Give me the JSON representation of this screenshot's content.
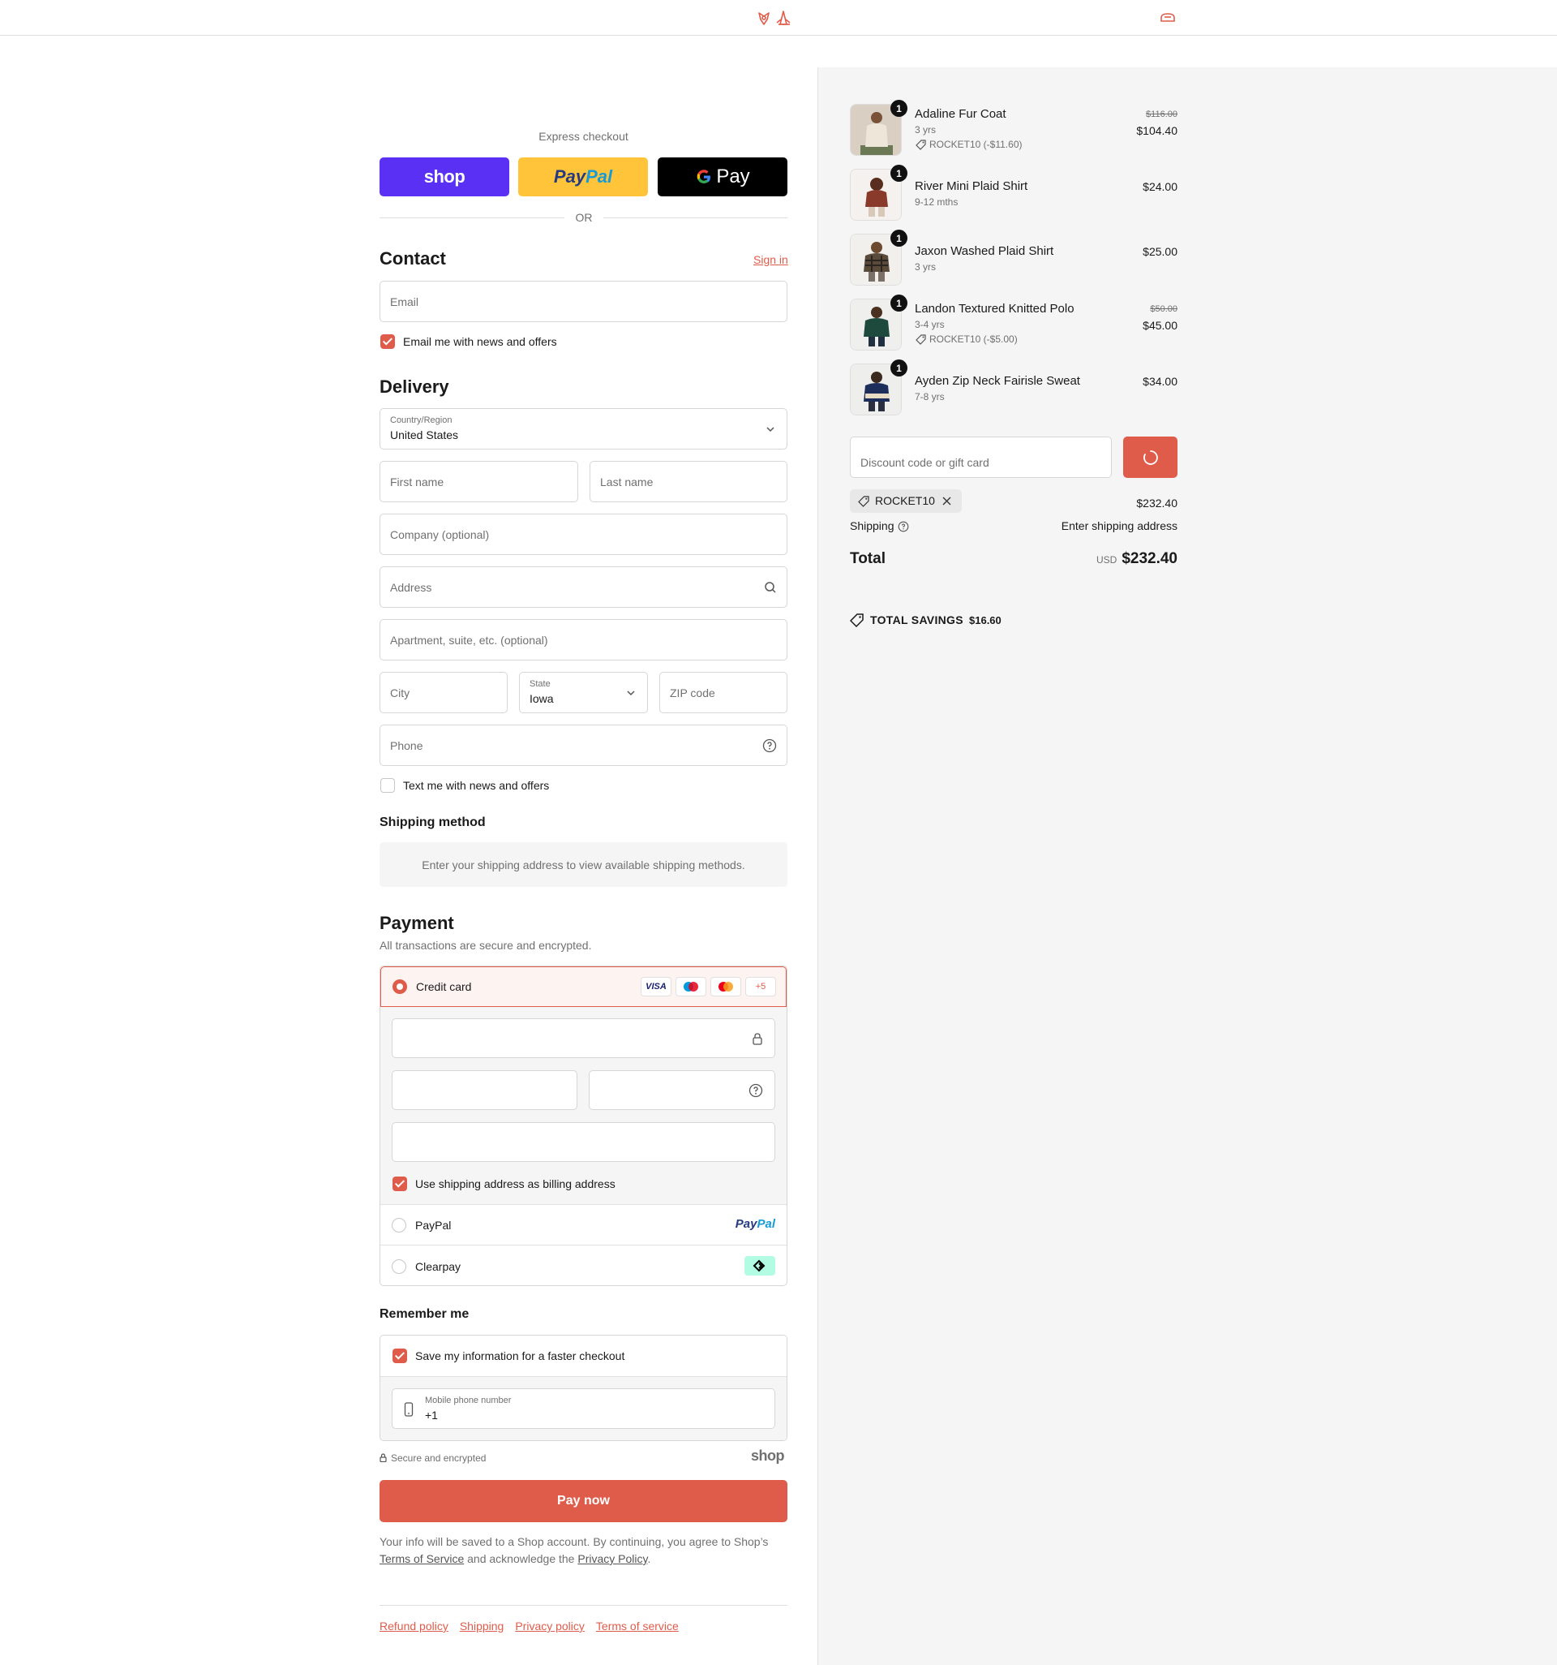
{
  "header": {
    "logo_icon": "rocket-flower-logo",
    "cart_icon": "cart-icon"
  },
  "express": {
    "title": "Express checkout",
    "shop_label": "shop",
    "paypal_label_1": "Pay",
    "paypal_label_2": "Pal",
    "gpay_label": "Pay",
    "or_label": "OR"
  },
  "contact": {
    "heading": "Contact",
    "sign_in": "Sign in",
    "email_placeholder": "Email",
    "email_offers": "Email me with news and offers"
  },
  "delivery": {
    "heading": "Delivery",
    "country_label": "Country/Region",
    "country_value": "United States",
    "first_name": "First name",
    "last_name": "Last name",
    "company": "Company (optional)",
    "address": "Address",
    "apartment": "Apartment, suite, etc. (optional)",
    "city": "City",
    "state_label": "State",
    "state_value": "Iowa",
    "zip": "ZIP code",
    "phone": "Phone",
    "text_offers": "Text me with news and offers"
  },
  "shipping_method": {
    "heading": "Shipping method",
    "message": "Enter your shipping address to view available shipping methods."
  },
  "payment": {
    "heading": "Payment",
    "subtitle": "All transactions are secure and encrypted.",
    "credit_card": "Credit card",
    "visa": "VISA",
    "more_cards": "+5",
    "billing_same": "Use shipping address as billing address",
    "paypal": "PayPal",
    "paypal_logo_1": "Pay",
    "paypal_logo_2": "Pal",
    "clearpay": "Clearpay"
  },
  "remember": {
    "heading": "Remember me",
    "save_info": "Save my information for a faster checkout",
    "mobile_label": "Mobile phone number",
    "mobile_value": "+1",
    "secure": "Secure and encrypted",
    "shop_logo": "shop"
  },
  "pay_now": "Pay now",
  "disclaimer": {
    "part1": "Your info will be saved to a Shop account. By continuing, you agree to Shop’s",
    "tos": "Terms of Service",
    "part2": "and acknowledge the",
    "privacy": "Privacy Policy",
    "end": "."
  },
  "footer_links": [
    "Refund policy",
    "Shipping",
    "Privacy policy",
    "Terms of service"
  ],
  "order": {
    "items": [
      {
        "name": "Adaline Fur Coat",
        "variant": "3 yrs",
        "discount": "ROCKET10 (-$11.60)",
        "original": "$116.00",
        "price": "$104.40",
        "qty": "1"
      },
      {
        "name": "River Mini Plaid Shirt",
        "variant": "9-12 mths",
        "price": "$24.00",
        "qty": "1"
      },
      {
        "name": "Jaxon Washed Plaid Shirt",
        "variant": "3 yrs",
        "price": "$25.00",
        "qty": "1"
      },
      {
        "name": "Landon Textured Knitted Polo",
        "variant": "3-4 yrs",
        "discount": "ROCKET10 (-$5.00)",
        "original": "$50.00",
        "price": "$45.00",
        "qty": "1"
      },
      {
        "name": "Ayden Zip Neck Fairisle Sweat",
        "variant": "7-8 yrs",
        "price": "$34.00",
        "qty": "1"
      }
    ],
    "discount_placeholder": "Discount code or gift card",
    "applied_code": "ROCKET10",
    "subtotal": "$232.40",
    "shipping_label": "Shipping",
    "shipping_value": "Enter shipping address",
    "total_label": "Total",
    "currency": "USD",
    "total": "$232.40",
    "savings_label": "TOTAL SAVINGS",
    "savings_value": "$16.60"
  },
  "colors": {
    "accent": "#e05c4a",
    "shop_purple": "#5a31f4",
    "paypal_yellow": "#ffc439",
    "gpay_black": "#000000",
    "panel_bg": "#f5f5f5"
  }
}
